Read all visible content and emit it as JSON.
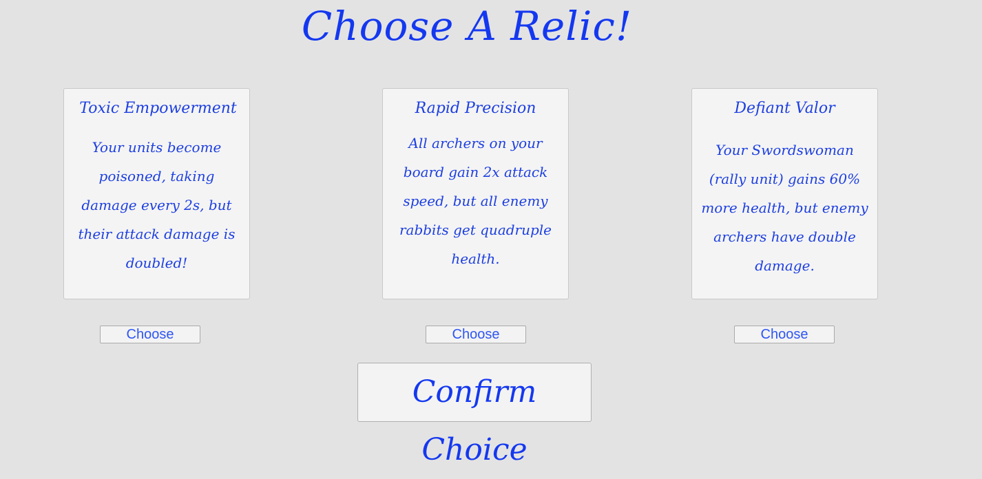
{
  "title": "Choose A Relic!",
  "relics": [
    {
      "name": "Toxic Empowerment",
      "description_lines": [
        "Your units become",
        "poisoned, taking",
        "damage every 2s, but",
        "their attack damage is",
        "doubled!"
      ],
      "choose_label": "Choose"
    },
    {
      "name": "Rapid Precision",
      "description_lines": [
        "All archers on your",
        "board gain 2x attack",
        "speed, but all enemy",
        "rabbits get quadruple",
        "health."
      ],
      "choose_label": "Choose"
    },
    {
      "name": "Defiant Valor",
      "description_lines": [
        "Your Swordswoman",
        "(rally unit) gains 60%",
        "more health, but enemy",
        "archers have double",
        "damage."
      ],
      "choose_label": "Choose"
    }
  ],
  "confirm_label": "Confirm Choice",
  "colors": {
    "background": "#e3e3e3",
    "accent_text": "#1438f0",
    "card_background": "#f4f4f4"
  }
}
